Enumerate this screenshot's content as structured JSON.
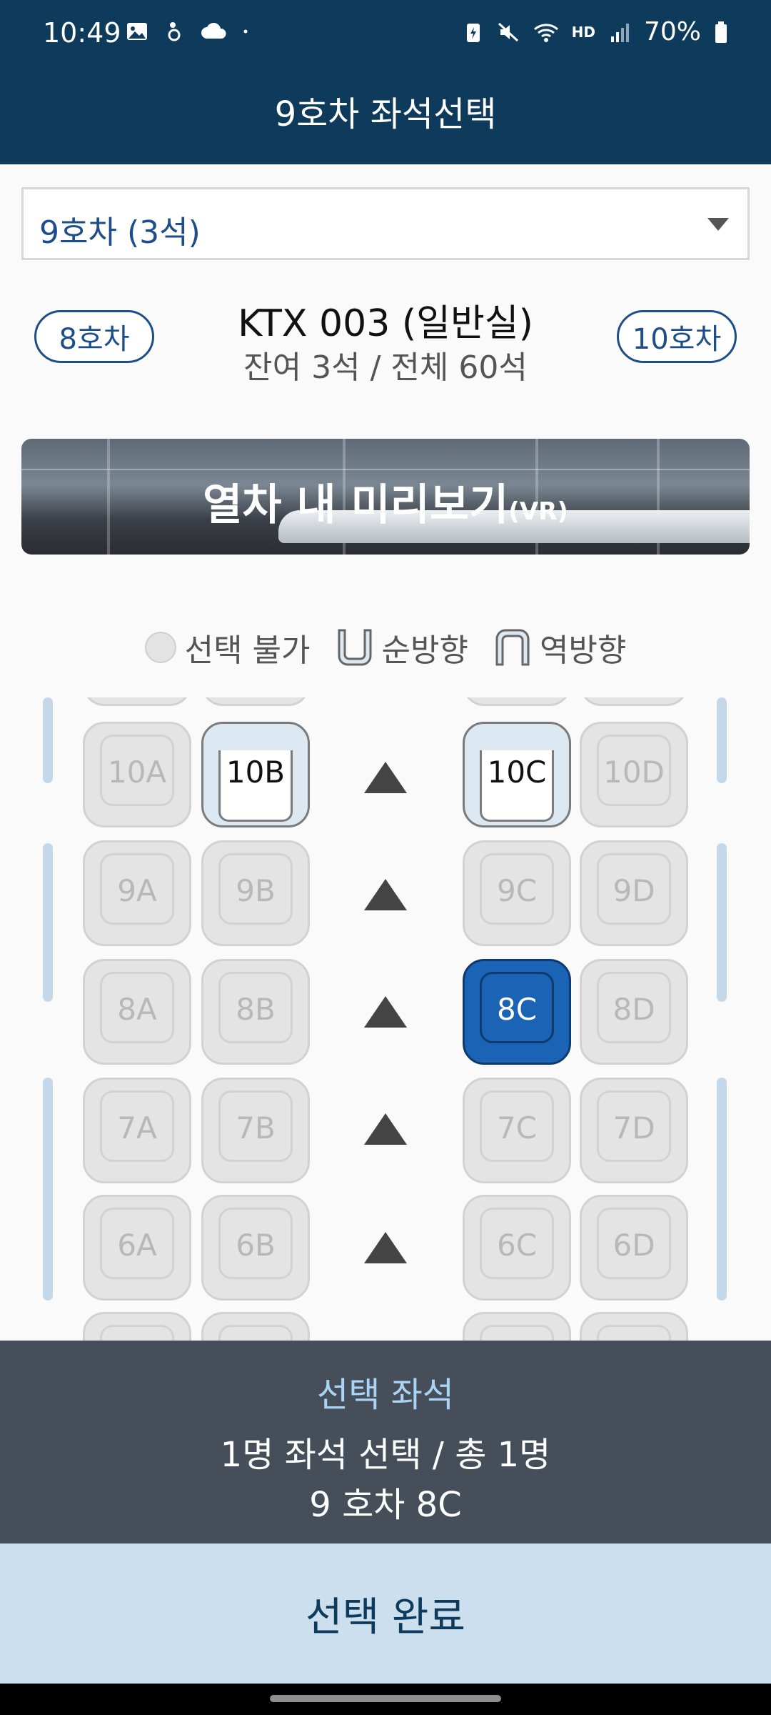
{
  "status_bar": {
    "time": "10:49",
    "battery": "70%",
    "hd_label": "HD"
  },
  "header": {
    "title": "9호차 좌석선택"
  },
  "car_selector": {
    "value": "9호차 (3석)"
  },
  "train_info": {
    "prev_car": "8호차",
    "next_car": "10호차",
    "title": "KTX 003 (일반실)",
    "subtitle": "잔여 3석 / 전체 60석"
  },
  "vr_banner": {
    "label": "열차 내 미리보기",
    "suffix": "(VR)"
  },
  "legend": {
    "unavailable": "선택 불가",
    "forward": "순방향",
    "reverse": "역방향"
  },
  "seats": {
    "r10": [
      "10A",
      "10B",
      "10C",
      "10D"
    ],
    "r9": [
      "9A",
      "9B",
      "9C",
      "9D"
    ],
    "r8": [
      "8A",
      "8B",
      "8C",
      "8D"
    ],
    "r7": [
      "7A",
      "7B",
      "7C",
      "7D"
    ],
    "r6": [
      "6A",
      "6B",
      "6C",
      "6D"
    ]
  },
  "selection": {
    "heading": "선택 좌석",
    "summary": "1명 좌석 선택 / 총 1명",
    "detail": "9 호차 8C"
  },
  "confirm_button": "선택 완료",
  "colors": {
    "header": "#0e3a5c",
    "selected_seat": "#1b63b5",
    "confirm_bg": "#cbdfee"
  }
}
